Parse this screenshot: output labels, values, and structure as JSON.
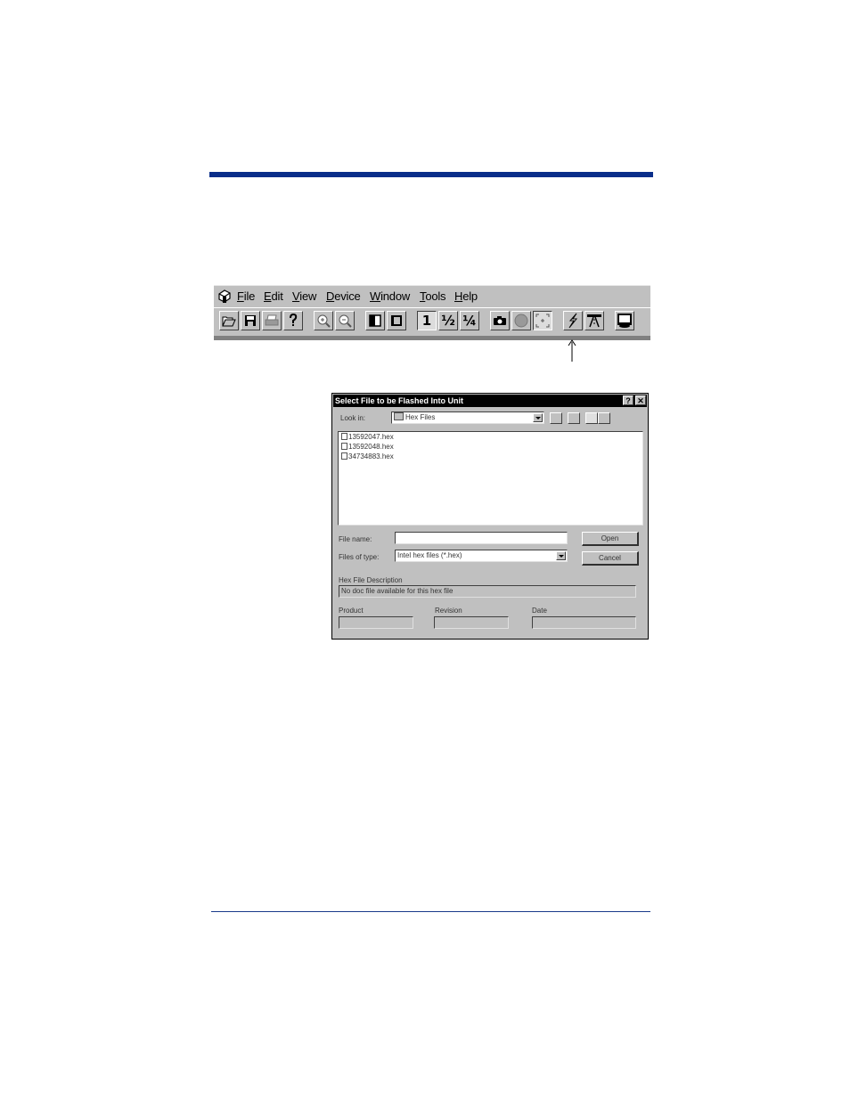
{
  "menubar": {
    "items": [
      {
        "ul": "F",
        "rest": "ile"
      },
      {
        "ul": "E",
        "rest": "dit"
      },
      {
        "ul": "V",
        "rest": "iew"
      },
      {
        "ul": "D",
        "rest": "evice"
      },
      {
        "ul": "W",
        "rest": "indow"
      },
      {
        "ul": "T",
        "rest": "ools"
      },
      {
        "ul": "H",
        "rest": "elp"
      }
    ]
  },
  "toolbar": {
    "zoom_full": "1",
    "zoom_half": "½",
    "zoom_quarter": "¼"
  },
  "dialog": {
    "title": "Select File to be Flashed Into Unit",
    "help_btn": "?",
    "close_btn": "✕",
    "look_in_label": "Look in:",
    "look_in_value": "Hex Files",
    "files": [
      "13592047.hex",
      "13592048.hex",
      "34734883.hex"
    ],
    "file_name_label": "File name:",
    "file_name_value": "",
    "files_of_type_label": "Files of type:",
    "files_of_type_value": "Intel hex files (*.hex)",
    "open_label": "Open",
    "cancel_label": "Cancel",
    "hex_desc_label": "Hex File Description",
    "hex_desc_value": "No doc file available for this hex file",
    "product_label": "Product",
    "revision_label": "Revision",
    "date_label": "Date",
    "product_value": "",
    "revision_value": "",
    "date_value": ""
  }
}
